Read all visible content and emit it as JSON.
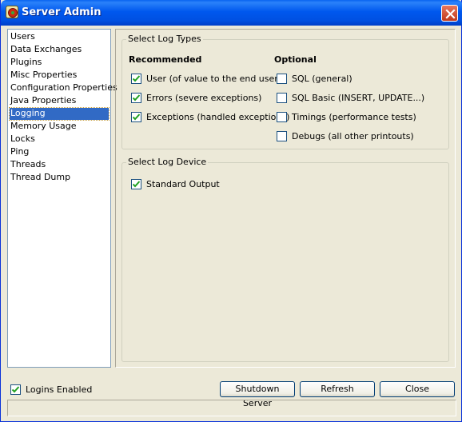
{
  "window": {
    "title": "Server Admin"
  },
  "sidebar": {
    "items": [
      {
        "label": "Users"
      },
      {
        "label": "Data Exchanges"
      },
      {
        "label": "Plugins"
      },
      {
        "label": "Misc Properties"
      },
      {
        "label": "Configuration Properties"
      },
      {
        "label": "Java Properties"
      },
      {
        "label": "Logging",
        "selected": true
      },
      {
        "label": "Memory Usage"
      },
      {
        "label": "Locks"
      },
      {
        "label": "Ping"
      },
      {
        "label": "Threads"
      },
      {
        "label": "Thread Dump"
      }
    ]
  },
  "log_types": {
    "group_label": "Select Log Types",
    "recommended_header": "Recommended",
    "optional_header": "Optional",
    "recommended": [
      {
        "label": "User (of value to the end user)",
        "checked": true
      },
      {
        "label": "Errors (severe exceptions)",
        "checked": true
      },
      {
        "label": "Exceptions (handled exceptions)",
        "checked": true
      }
    ],
    "optional": [
      {
        "label": "SQL (general)",
        "checked": false
      },
      {
        "label": "SQL Basic (INSERT, UPDATE...)",
        "checked": false
      },
      {
        "label": "Timings (performance tests)",
        "checked": false
      },
      {
        "label": "Debugs (all other printouts)",
        "checked": false
      }
    ]
  },
  "log_device": {
    "group_label": "Select Log Device",
    "options": [
      {
        "label": "Standard Output",
        "checked": true
      }
    ]
  },
  "footer": {
    "logins_enabled": {
      "label": "Logins Enabled",
      "checked": true
    },
    "shutdown_label": "Shutdown Server",
    "refresh_label": "Refresh",
    "close_label": "Close"
  },
  "colors": {
    "title_bar": "#0058ee",
    "selection": "#316ac5",
    "panel": "#ece9d8"
  }
}
